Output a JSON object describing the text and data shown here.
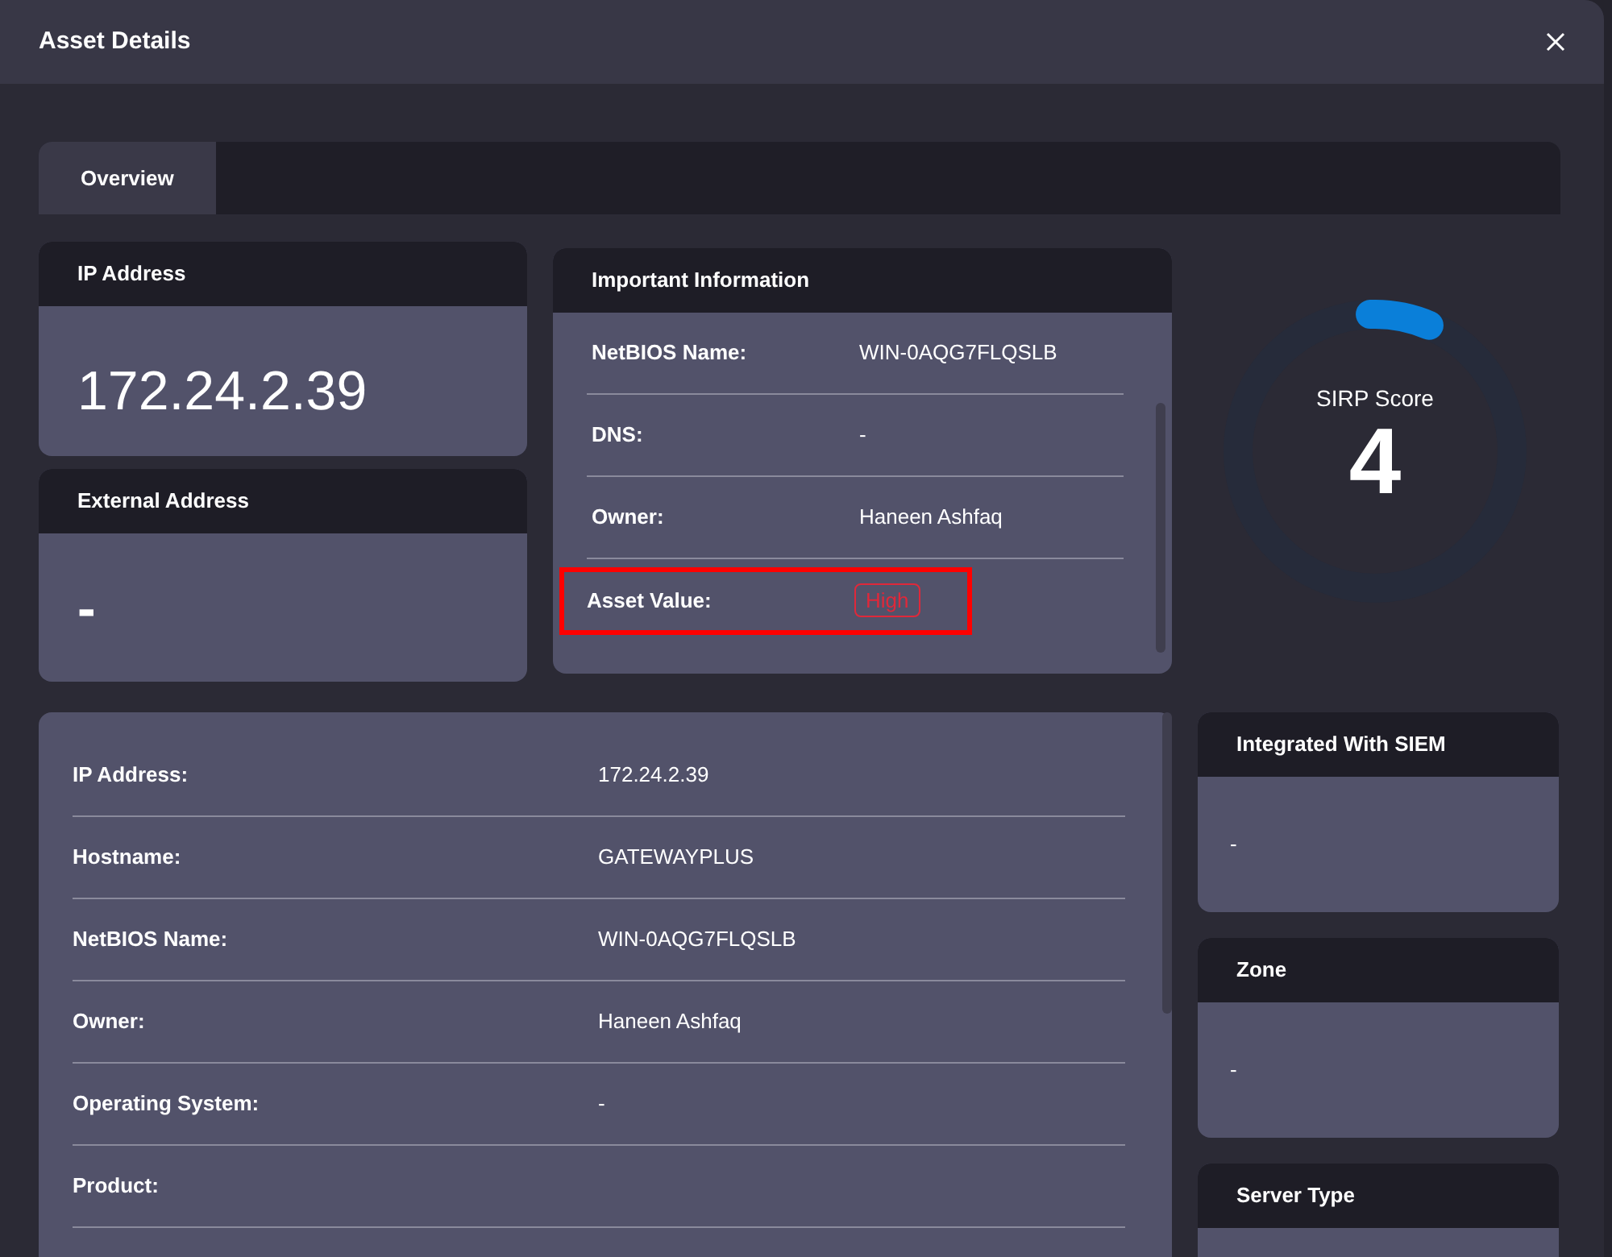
{
  "dialog": {
    "title": "Asset Details"
  },
  "tabs": [
    {
      "label": "Overview",
      "selected": true
    }
  ],
  "ip_card": {
    "title": "IP Address",
    "value": "172.24.2.39"
  },
  "external_card": {
    "title": "External Address",
    "value": "-"
  },
  "important": {
    "title": "Important Information",
    "rows": [
      {
        "label": "NetBIOS Name:",
        "value": "WIN-0AQG7FLQSLB",
        "kind": "text",
        "highlighted": false
      },
      {
        "label": "DNS:",
        "value": "-",
        "kind": "text",
        "highlighted": false
      },
      {
        "label": "Owner:",
        "value": "Haneen Ashfaq",
        "kind": "text",
        "highlighted": false
      },
      {
        "label": "Asset Value:",
        "value": "High",
        "kind": "badge",
        "highlighted": true
      }
    ]
  },
  "score": {
    "label": "SIRP Score",
    "value": "4",
    "level": 0.07
  },
  "details": [
    {
      "label": "IP Address:",
      "value": "172.24.2.39"
    },
    {
      "label": "Hostname:",
      "value": "GATEWAYPLUS"
    },
    {
      "label": "NetBIOS Name:",
      "value": "WIN-0AQG7FLQSLB"
    },
    {
      "label": "Owner:",
      "value": "Haneen Ashfaq"
    },
    {
      "label": "Operating System:",
      "value": "-"
    },
    {
      "label": "Product:"
    }
  ],
  "side_cards": [
    {
      "title": "Integrated With SIEM",
      "value": "-"
    },
    {
      "title": "Zone",
      "value": "-"
    },
    {
      "title": "Server Type"
    }
  ]
}
